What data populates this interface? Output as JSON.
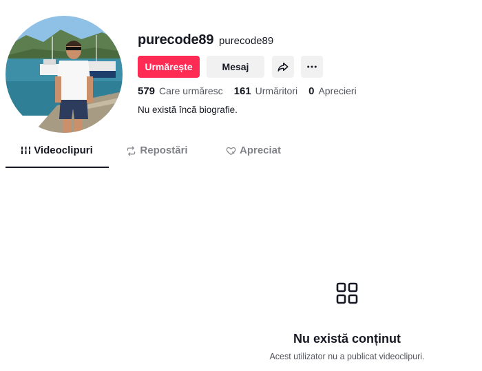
{
  "profile": {
    "username": "purecode89",
    "nickname": "purecode89",
    "bio": "Nu există încă biografie.",
    "avatar_icon": "profile-photo"
  },
  "actions": {
    "follow_label": "Urmărește",
    "message_label": "Mesaj",
    "share_icon": "share-icon",
    "more_icon": "more-icon"
  },
  "stats": {
    "following_count": "579",
    "following_label": "Care urmăresc",
    "followers_count": "161",
    "followers_label": "Urmăritori",
    "likes_count": "0",
    "likes_label": "Aprecieri"
  },
  "tabs": [
    {
      "label": "Videoclipuri",
      "icon": "grid-lines-icon",
      "active": true
    },
    {
      "label": "Repostări",
      "icon": "repost-icon",
      "active": false
    },
    {
      "label": "Apreciat",
      "icon": "heart-icon",
      "active": false
    }
  ],
  "empty_state": {
    "icon": "grid-icon",
    "title": "Nu există conținut",
    "description": "Acest utilizator nu a publicat videoclipuri."
  },
  "colors": {
    "accent": "#fe2c55",
    "text": "#161823",
    "button_bg": "#f1f1f2"
  }
}
